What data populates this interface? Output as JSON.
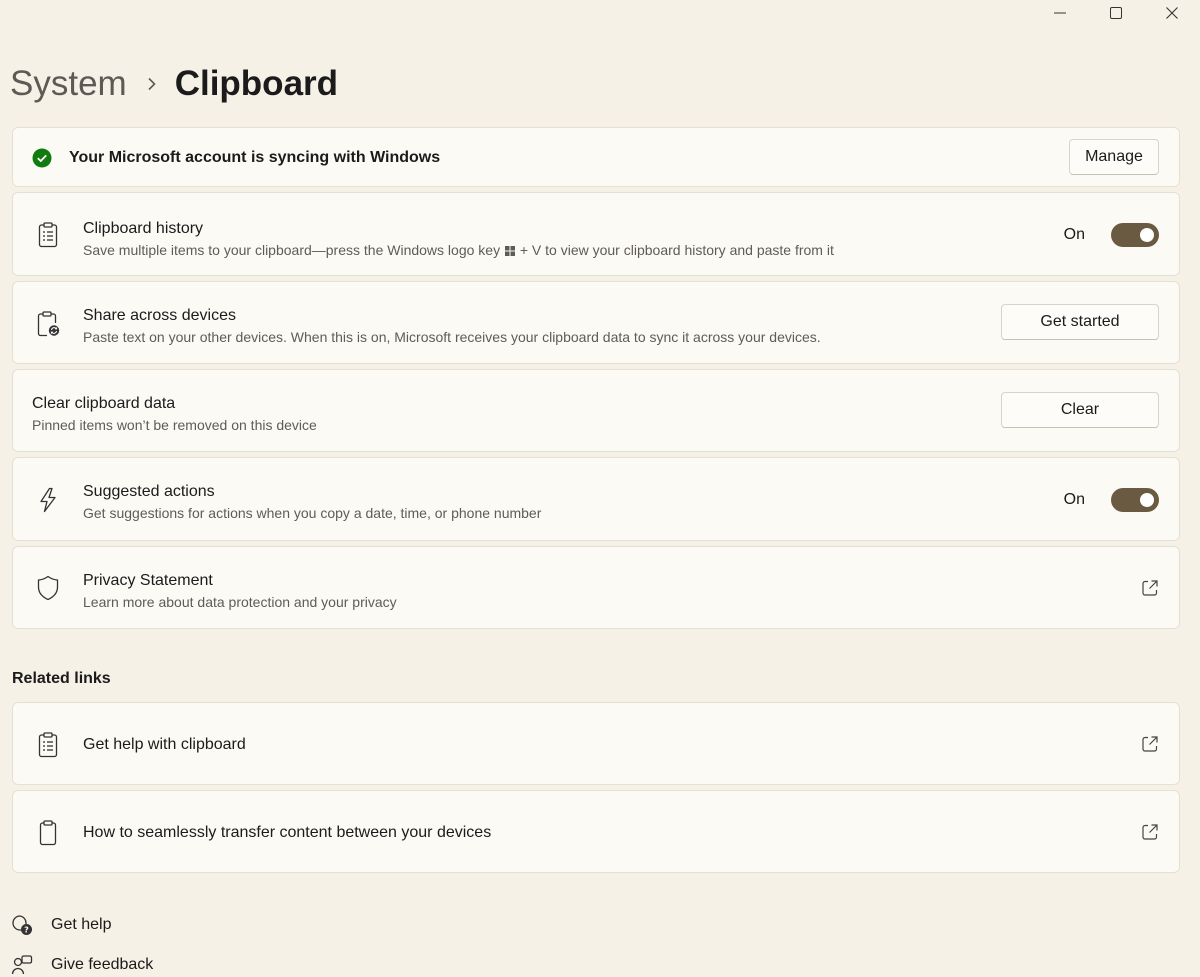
{
  "breadcrumb": {
    "parent": "System",
    "current": "Clipboard"
  },
  "sync_banner": {
    "text": "Your Microsoft account is syncing with Windows",
    "button": "Manage",
    "status_color": "#107c10"
  },
  "clipboard_history": {
    "title": "Clipboard history",
    "subtitle_before": "Save multiple items to your clipboard—press the Windows logo key",
    "subtitle_after": "+ V to view your clipboard history and paste from it",
    "state": "On"
  },
  "share_devices": {
    "title": "Share across devices",
    "subtitle": "Paste text on your other devices. When this is on, Microsoft receives your clipboard data to sync it across your devices.",
    "button": "Get started"
  },
  "clear_data": {
    "title": "Clear clipboard data",
    "subtitle": "Pinned items won’t be removed on this device",
    "button": "Clear"
  },
  "suggested_actions": {
    "title": "Suggested actions",
    "subtitle": "Get suggestions for actions when you copy a date, time, or phone number",
    "state": "On"
  },
  "privacy": {
    "title": "Privacy Statement",
    "subtitle": "Learn more about data protection and your privacy"
  },
  "related": {
    "label": "Related links",
    "items": [
      {
        "label": "Get help with clipboard"
      },
      {
        "label": "How to seamlessly transfer content between your devices"
      }
    ]
  },
  "footer": {
    "help": "Get help",
    "feedback": "Give feedback"
  },
  "colors": {
    "background": "#f6f1e6",
    "card": "#fcfaf5",
    "toggle_on": "#6b5a42"
  }
}
